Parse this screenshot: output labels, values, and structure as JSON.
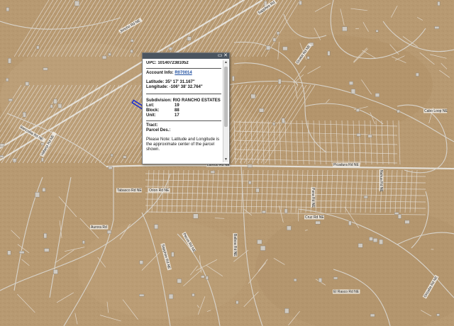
{
  "popup": {
    "upc_label": "UPC:",
    "upc_value": "1014072381052",
    "account_label": "Account Info:",
    "account_value": "R070014",
    "latitude_label": "Latitude:",
    "latitude_value": "35° 17' 31.167\"",
    "longitude_label": "Longitude:",
    "longitude_value": "-106° 38' 32.764\"",
    "subdivision_label": "Subdivision:",
    "subdivision_value": "RIO RANCHO ESTATES",
    "lot_label": "Lot:",
    "lot_value": "19",
    "block_label": "Block:",
    "block_value": "88",
    "unit_label": "Unit:",
    "unit_value": "17",
    "tract_label": "Tract:",
    "tract_value": "",
    "parcel_label": "Parcel Des.:",
    "parcel_value": "",
    "note": "Please Note: Latitude and Longitude is the approximate center of the parcel shown.",
    "minimize_glyph": "▭",
    "close_glyph": "✕",
    "scroll_up_glyph": "▲",
    "scroll_down_glyph": "▼"
  },
  "map": {
    "colors": {
      "terrain": "#b89a72",
      "road": "#e4e0d8",
      "lot_line": "#e6e2da",
      "selected_parcel": "#2233cc"
    },
    "street_labels": [
      "Jericho Rd NE",
      "Sapphire Rd",
      "Ocelot Rd NE",
      "Cabo Loop NE",
      "Laredo Rd NE",
      "Picadura Rd NE",
      "Nahua Rd NE",
      "Tabasco Rd NE",
      "Aurora Rd",
      "Sapphire Rd NE",
      "Pecos Rd NE",
      "Cruz Rd NE",
      "Pana Rd NE",
      "El Rasco Rd NE",
      "Orizaba Rd NE",
      "Orion Rd NE",
      "Balboa Rd NE",
      "Vallarta Rd NE",
      "Bancolita Rd NE"
    ]
  }
}
